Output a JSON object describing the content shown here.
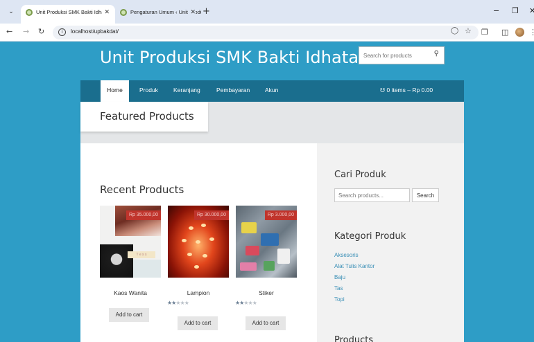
{
  "browser": {
    "tabs": [
      {
        "title": "Unit Produksi SMK Bakti Idhata",
        "active": true
      },
      {
        "title": "Pengaturan Umum ‹ Unit Produ",
        "active": false
      }
    ],
    "tab_close_glyph": "✕",
    "new_tab_glyph": "+",
    "url": "localhost/upbakdat/",
    "window_controls": {
      "minimize": "−",
      "restore": "❐",
      "close": "✕"
    }
  },
  "site": {
    "title": "Unit Produksi SMK Bakti Idhata",
    "search_placeholder": "Search for products",
    "nav": [
      {
        "label": "Home",
        "active": true
      },
      {
        "label": "Produk"
      },
      {
        "label": "Keranjang"
      },
      {
        "label": "Pembayaran"
      },
      {
        "label": "Akun"
      }
    ],
    "cart": "0 items – Rp 0.00",
    "featured_title": "Featured Products"
  },
  "recent": {
    "title": "Recent Products",
    "products": [
      {
        "name": "Kaos Wanita",
        "price": "Rp 35.000,00",
        "rating": 0,
        "add_label": "Add to cart",
        "image_caption": "T e s s"
      },
      {
        "name": "Lampion",
        "price": "Rp 30.000,00",
        "rating": 2,
        "add_label": "Add to cart"
      },
      {
        "name": "Stiker",
        "price": "Rp 3.000,00",
        "rating": 2,
        "add_label": "Add to cart"
      }
    ]
  },
  "sidebar": {
    "search_title": "Cari Produk",
    "search_placeholder": "Search products...",
    "search_button": "Search",
    "category_title": "Kategori Produk",
    "categories": [
      "Aksesoris",
      "Alat Tulis Kantor",
      "Baju",
      "Tas",
      "Topi"
    ],
    "products_title": "Products"
  },
  "colors": {
    "background": "#2e9dc6",
    "nav": "#1a6e8e",
    "price_badge": "#c0342c",
    "link": "#3a8fb6"
  },
  "icons": [
    "chevron-down-icon",
    "globe-icon",
    "close-icon",
    "back-icon",
    "forward-icon",
    "reload-icon",
    "info-icon",
    "translate-icon",
    "star-icon",
    "extensions-icon",
    "sidebar-icon",
    "search-icon",
    "cart-icon"
  ]
}
